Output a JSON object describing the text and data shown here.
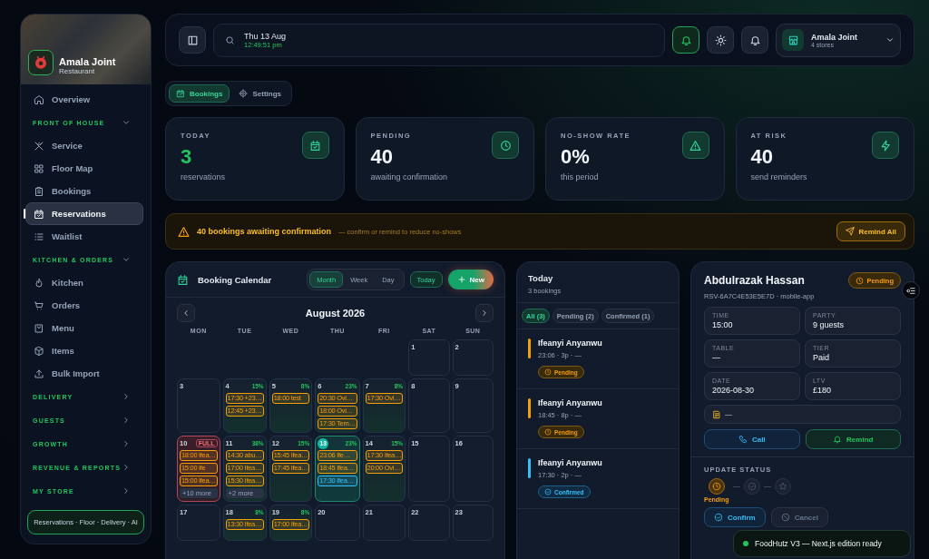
{
  "sidebar": {
    "brand": {
      "name": "Amala Joint",
      "subtitle": "Restaurant"
    },
    "items": [
      {
        "kind": "link",
        "label": "Overview",
        "selected": false
      },
      {
        "kind": "section",
        "label": "FRONT OF HOUSE",
        "expanded": true
      },
      {
        "kind": "link",
        "label": "Service",
        "selected": false
      },
      {
        "kind": "link",
        "label": "Floor Map",
        "selected": false
      },
      {
        "kind": "link",
        "label": "Bookings",
        "selected": false
      },
      {
        "kind": "link",
        "label": "Reservations",
        "selected": true
      },
      {
        "kind": "link",
        "label": "Waitlist",
        "selected": false
      },
      {
        "kind": "section",
        "label": "KITCHEN & ORDERS",
        "expanded": true
      },
      {
        "kind": "link",
        "label": "Kitchen",
        "selected": false
      },
      {
        "kind": "link",
        "label": "Orders",
        "selected": false
      },
      {
        "kind": "link",
        "label": "Menu",
        "selected": false
      },
      {
        "kind": "link",
        "label": "Items",
        "selected": false
      },
      {
        "kind": "link",
        "label": "Bulk Import",
        "selected": false
      },
      {
        "kind": "section",
        "label": "DELIVERY",
        "expanded": false
      },
      {
        "kind": "section",
        "label": "GUESTS",
        "expanded": false
      },
      {
        "kind": "section",
        "label": "GROWTH",
        "expanded": false
      },
      {
        "kind": "section",
        "label": "REVENUE & REPORTS",
        "expanded": false
      },
      {
        "kind": "section",
        "label": "MY STORE",
        "expanded": false
      }
    ],
    "footer": "Reservations · Floor · Delivery · AI"
  },
  "topbar": {
    "date": "Thu 13 Aug",
    "time": "12:49:51 pm",
    "store": {
      "name": "Amala Joint",
      "detail": "4 stores"
    }
  },
  "tabs": [
    {
      "label": "Bookings",
      "selected": true
    },
    {
      "label": "Settings",
      "selected": false
    }
  ],
  "stats": [
    {
      "label": "TODAY",
      "value": "3",
      "caption": "reservations",
      "color": "#22c55e"
    },
    {
      "label": "PENDING",
      "value": "40",
      "caption": "awaiting confirmation",
      "color": "#f1f5f9"
    },
    {
      "label": "NO-SHOW RATE",
      "value": "0%",
      "caption": "this period",
      "color": "#f1f5f9"
    },
    {
      "label": "AT RISK",
      "value": "40",
      "caption": "send reminders",
      "color": "#f1f5f9"
    }
  ],
  "alert": {
    "title": "40 bookings awaiting confirmation",
    "detail": "— confirm or remind to reduce no-shows",
    "action": "Remind All"
  },
  "calendar": {
    "title": "Booking Calendar",
    "views": [
      {
        "label": "Month",
        "selected": true
      },
      {
        "label": "Week",
        "selected": false
      },
      {
        "label": "Day",
        "selected": false
      }
    ],
    "today_button": "Today",
    "new_button": "New",
    "month": "August 2026",
    "weekdays": [
      "MON",
      "TUE",
      "WED",
      "THU",
      "FRI",
      "SAT",
      "SUN"
    ],
    "weeks": [
      [
        {
          "kind": "empty"
        },
        {
          "kind": "empty"
        },
        {
          "kind": "empty"
        },
        {
          "kind": "empty"
        },
        {
          "kind": "empty"
        },
        {
          "day": "1",
          "full": false,
          "today": false
        },
        {
          "day": "2",
          "full": false,
          "today": false
        }
      ],
      [
        {
          "day": "3",
          "full": false,
          "today": false
        },
        {
          "day": "4",
          "occupancy": "15%",
          "full": false,
          "today": false,
          "events": [
            {
              "text": "17:30 +23…",
              "color": "#f59e0b"
            },
            {
              "text": "12:45 +23…",
              "color": "#f59e0b"
            }
          ]
        },
        {
          "day": "5",
          "occupancy": "8%",
          "full": false,
          "today": false,
          "events": [
            {
              "text": "18:00 test",
              "color": "#f59e0b"
            }
          ]
        },
        {
          "day": "6",
          "occupancy": "23%",
          "full": false,
          "today": false,
          "events": [
            {
              "text": "20:30 Ovi…",
              "color": "#f59e0b"
            },
            {
              "text": "18:00 Ovi…",
              "color": "#f59e0b"
            },
            {
              "text": "17:30 Tem…",
              "color": "#f59e0b"
            }
          ]
        },
        {
          "day": "7",
          "occupancy": "8%",
          "full": false,
          "today": false,
          "events": [
            {
              "text": "17:30 Ovi…",
              "color": "#f59e0b"
            }
          ]
        },
        {
          "day": "8",
          "full": false,
          "today": false
        },
        {
          "day": "9",
          "full": false,
          "today": false
        }
      ],
      [
        {
          "day": "10",
          "badge": "FULL",
          "full": true,
          "today": false,
          "events": [
            {
              "text": "18:00 Ifea…",
              "color": "#f59e0b"
            },
            {
              "text": "15:00 Ife",
              "color": "#f59e0b"
            },
            {
              "text": "15:00 Ifea…",
              "color": "#f59e0b"
            }
          ],
          "more": "+10 more"
        },
        {
          "day": "11",
          "occupancy": "38%",
          "full": false,
          "today": false,
          "events": [
            {
              "text": "14:30 abu…",
              "color": "#f59e0b"
            },
            {
              "text": "17:00 Ifea…",
              "color": "#f59e0b"
            },
            {
              "text": "15:30 Ifea…",
              "color": "#f59e0b"
            }
          ],
          "more": "+2 more"
        },
        {
          "day": "12",
          "occupancy": "15%",
          "full": false,
          "today": false,
          "events": [
            {
              "text": "15:45 Ifea…",
              "color": "#f59e0b"
            },
            {
              "text": "17:45 Ifea…",
              "color": "#f59e0b"
            }
          ]
        },
        {
          "day": "13",
          "occupancy": "23%",
          "full": false,
          "today": true,
          "events": [
            {
              "text": "23:06 Ife…",
              "color": "#f59e0b"
            },
            {
              "text": "18:45 Ifea…",
              "color": "#f59e0b"
            },
            {
              "text": "17:30 Ifea…",
              "color": "#38bdf8"
            }
          ]
        },
        {
          "day": "14",
          "occupancy": "15%",
          "full": false,
          "today": false,
          "events": [
            {
              "text": "17:30 Ifea…",
              "color": "#f59e0b"
            },
            {
              "text": "20:00 Ovi…",
              "color": "#f59e0b"
            }
          ]
        },
        {
          "day": "15",
          "full": false,
          "today": false
        },
        {
          "day": "16",
          "full": false,
          "today": false
        }
      ],
      [
        {
          "day": "17",
          "full": false,
          "today": false
        },
        {
          "day": "18",
          "occupancy": "8%",
          "full": false,
          "today": false,
          "events": [
            {
              "text": "13:30 Ifea…",
              "color": "#f59e0b"
            }
          ]
        },
        {
          "day": "19",
          "occupancy": "8%",
          "full": false,
          "today": false,
          "events": [
            {
              "text": "17:00 Ifea…",
              "color": "#f59e0b"
            }
          ]
        },
        {
          "day": "20",
          "full": false,
          "today": false
        },
        {
          "day": "21",
          "full": false,
          "today": false
        },
        {
          "day": "22",
          "full": false,
          "today": false
        },
        {
          "day": "23",
          "full": false,
          "today": false
        }
      ]
    ]
  },
  "today": {
    "title": "Today",
    "subtitle": "3 bookings",
    "filters": [
      {
        "label": "All (3)",
        "selected": true
      },
      {
        "label": "Pending (2)",
        "selected": false
      },
      {
        "label": "Confirmed (1)",
        "selected": false
      }
    ],
    "bookings": [
      {
        "name": "Ifeanyi Anyanwu",
        "meta": "23:06 · 3p · —",
        "kind": "pending",
        "status_label": "Pending"
      },
      {
        "name": "Ifeanyi Anyanwu",
        "meta": "18:45 · 8p · —",
        "kind": "pending",
        "status_label": "Pending"
      },
      {
        "name": "Ifeanyi Anyanwu",
        "meta": "17:30 · 2p · —",
        "kind": "confirmed",
        "status_label": "Confirmed"
      }
    ]
  },
  "details": {
    "name": "Abdulrazak Hassan",
    "kind": "pending",
    "status_label": "Pending",
    "reference": "RSV-6A7C4E53E5E7D · mobile-app",
    "fields": [
      {
        "label": "TIME",
        "value": "15:00"
      },
      {
        "label": "PARTY",
        "value": "9 guests"
      },
      {
        "label": "TABLE",
        "value": "—"
      },
      {
        "label": "TIER",
        "value": "Paid"
      },
      {
        "label": "DATE",
        "value": "2026-08-30"
      },
      {
        "label": "LTV",
        "value": "£180"
      }
    ],
    "note": "—",
    "call": "Call",
    "remind": "Remind",
    "update_heading": "UPDATE STATUS",
    "steps": [
      {
        "kind": "pending",
        "label": "Pending",
        "selected": true
      },
      {
        "kind": "confirmed",
        "selected": false
      },
      {
        "kind": "seated",
        "selected": false
      }
    ],
    "confirm": "Confirm",
    "cancel": "Cancel"
  },
  "toast": {
    "text": "FoodHutz V3 — Next.js edition ready"
  }
}
